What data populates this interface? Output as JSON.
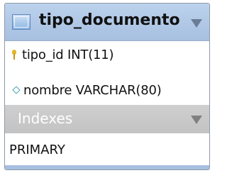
{
  "table": {
    "name": "tipo_documento",
    "columns": [
      {
        "text": "tipo_id INT(11)",
        "icon": "primary-key-icon"
      },
      {
        "text": "nombre VARCHAR(80)",
        "icon": "column-diamond-icon"
      }
    ],
    "indexes": {
      "title": "Indexes",
      "items": [
        "PRIMARY"
      ]
    }
  },
  "colors": {
    "header": "#a7c0e1",
    "indexes_header": "#c8c8c8",
    "primary_key": "#e5b52a",
    "column_diamond": "#4aa3b2"
  }
}
